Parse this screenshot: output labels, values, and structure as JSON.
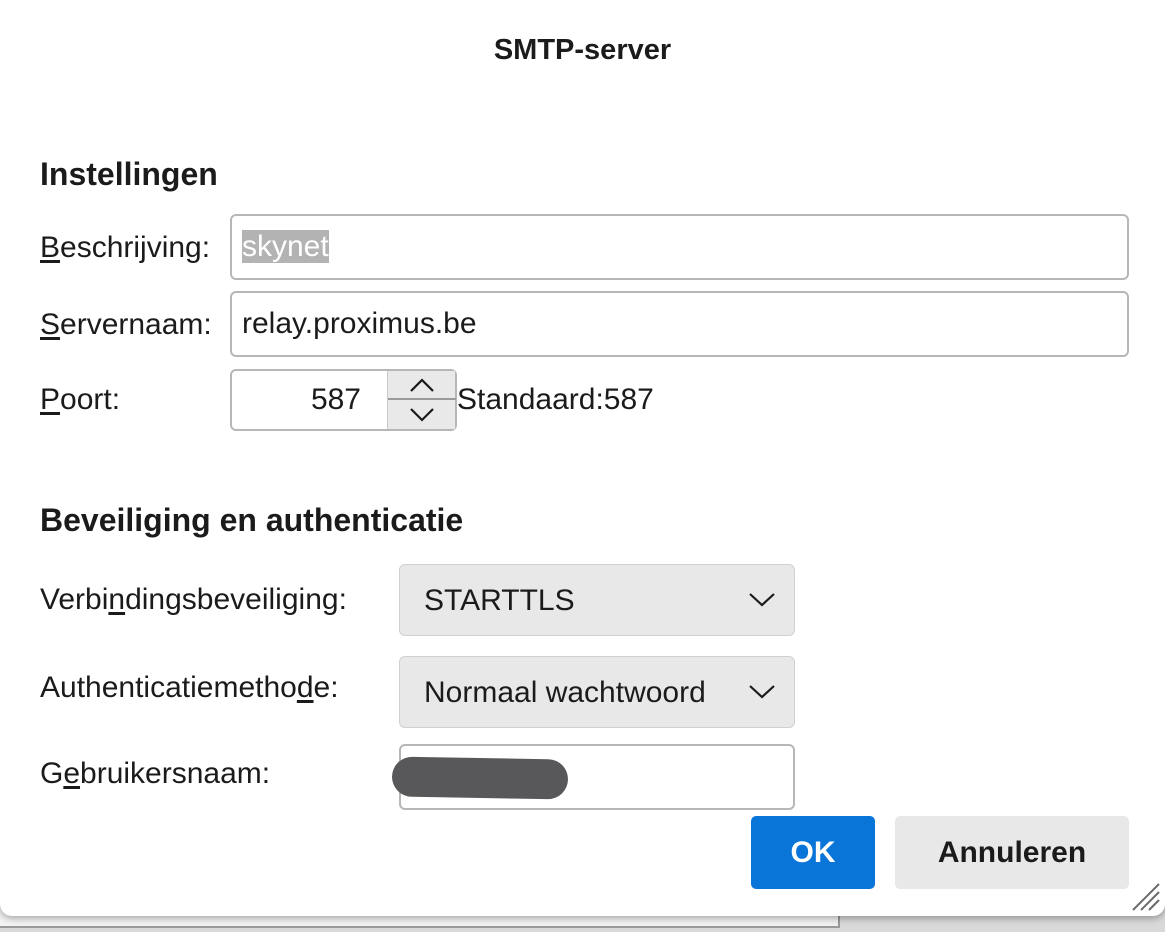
{
  "dialog": {
    "title": "SMTP-server"
  },
  "settings": {
    "heading": "Instellingen",
    "description": {
      "label_pre": "",
      "label_key": "B",
      "label_post": "eschrijving:",
      "value": "skynet"
    },
    "servername": {
      "label_pre": "",
      "label_key": "S",
      "label_post": "ervernaam:",
      "value": "relay.proximus.be"
    },
    "port": {
      "label_pre": "",
      "label_key": "P",
      "label_post": "oort:",
      "value": "587",
      "default_text": "Standaard:587"
    }
  },
  "security": {
    "heading": "Beveiliging en authenticatie",
    "connection": {
      "label_pre": "Verbi",
      "label_key": "n",
      "label_post": "dingsbeveiliging:",
      "selected": "STARTTLS"
    },
    "auth_method": {
      "label_pre": "Authenticatiemetho",
      "label_key": "d",
      "label_post": "e:",
      "selected": "Normaal wachtwoord"
    },
    "username": {
      "label_pre": "G",
      "label_key": "e",
      "label_post": "bruikersnaam:",
      "value": ""
    }
  },
  "buttons": {
    "ok": "OK",
    "cancel": "Annuleren"
  },
  "colors": {
    "accent": "#0a75d8",
    "redaction": "#58585a"
  }
}
